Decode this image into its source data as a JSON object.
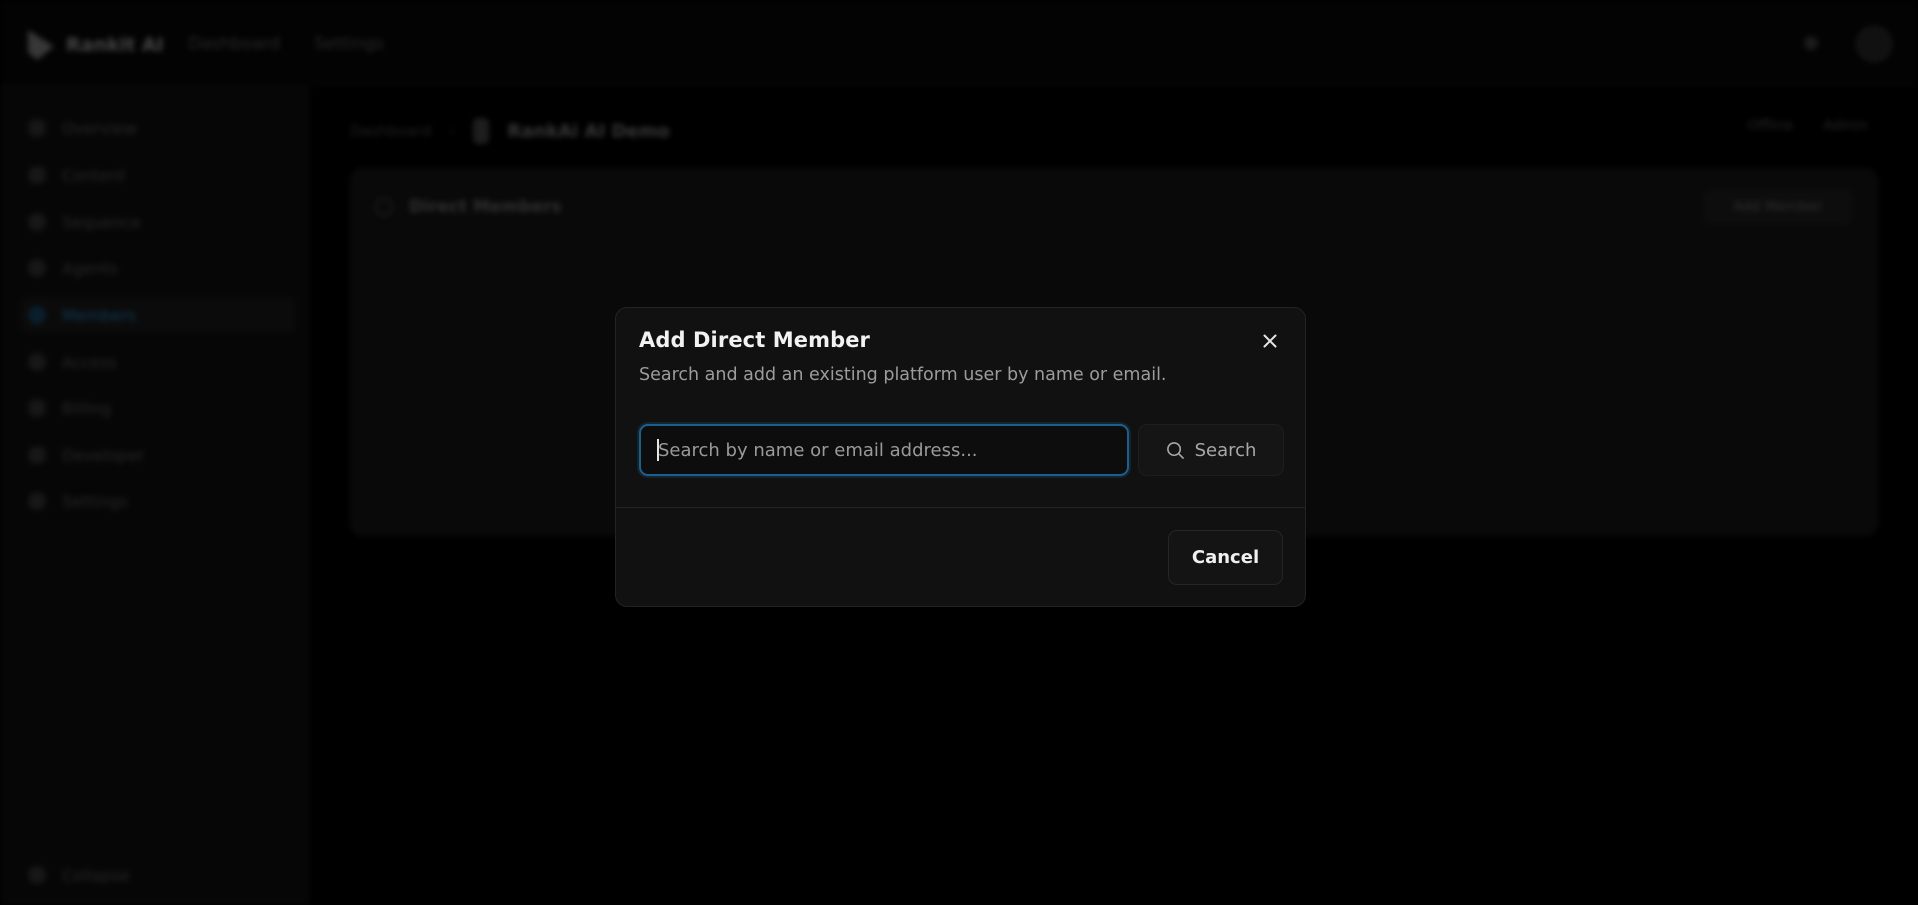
{
  "app": {
    "brand": "Rankit AI",
    "top_nav": [
      "Dashboard",
      "Settings"
    ]
  },
  "sidebar": {
    "items": [
      {
        "label": "Overview"
      },
      {
        "label": "Content"
      },
      {
        "label": "Sequence"
      },
      {
        "label": "Agents"
      },
      {
        "label": "Members"
      },
      {
        "label": "Access"
      },
      {
        "label": "Billing"
      },
      {
        "label": "Developer"
      },
      {
        "label": "Settings"
      }
    ],
    "collapse_label": "Collapse"
  },
  "breadcrumb": {
    "parent": "Dashboard",
    "separator": "›",
    "current": "RankAi AI Demo"
  },
  "header_right": {
    "status": "Offline",
    "action": "Admin"
  },
  "card": {
    "title": "Direct Members",
    "button_label": "Add Member"
  },
  "modal": {
    "title": "Add Direct Member",
    "description": "Search and add an existing platform user by name or email.",
    "search_input": {
      "value": "",
      "placeholder": "Search by name or email address..."
    },
    "search_button_label": "Search",
    "cancel_label": "Cancel"
  },
  "colors": {
    "accent": "#1d5e8b",
    "modal_bg": "#111111",
    "page_bg": "#000000"
  }
}
